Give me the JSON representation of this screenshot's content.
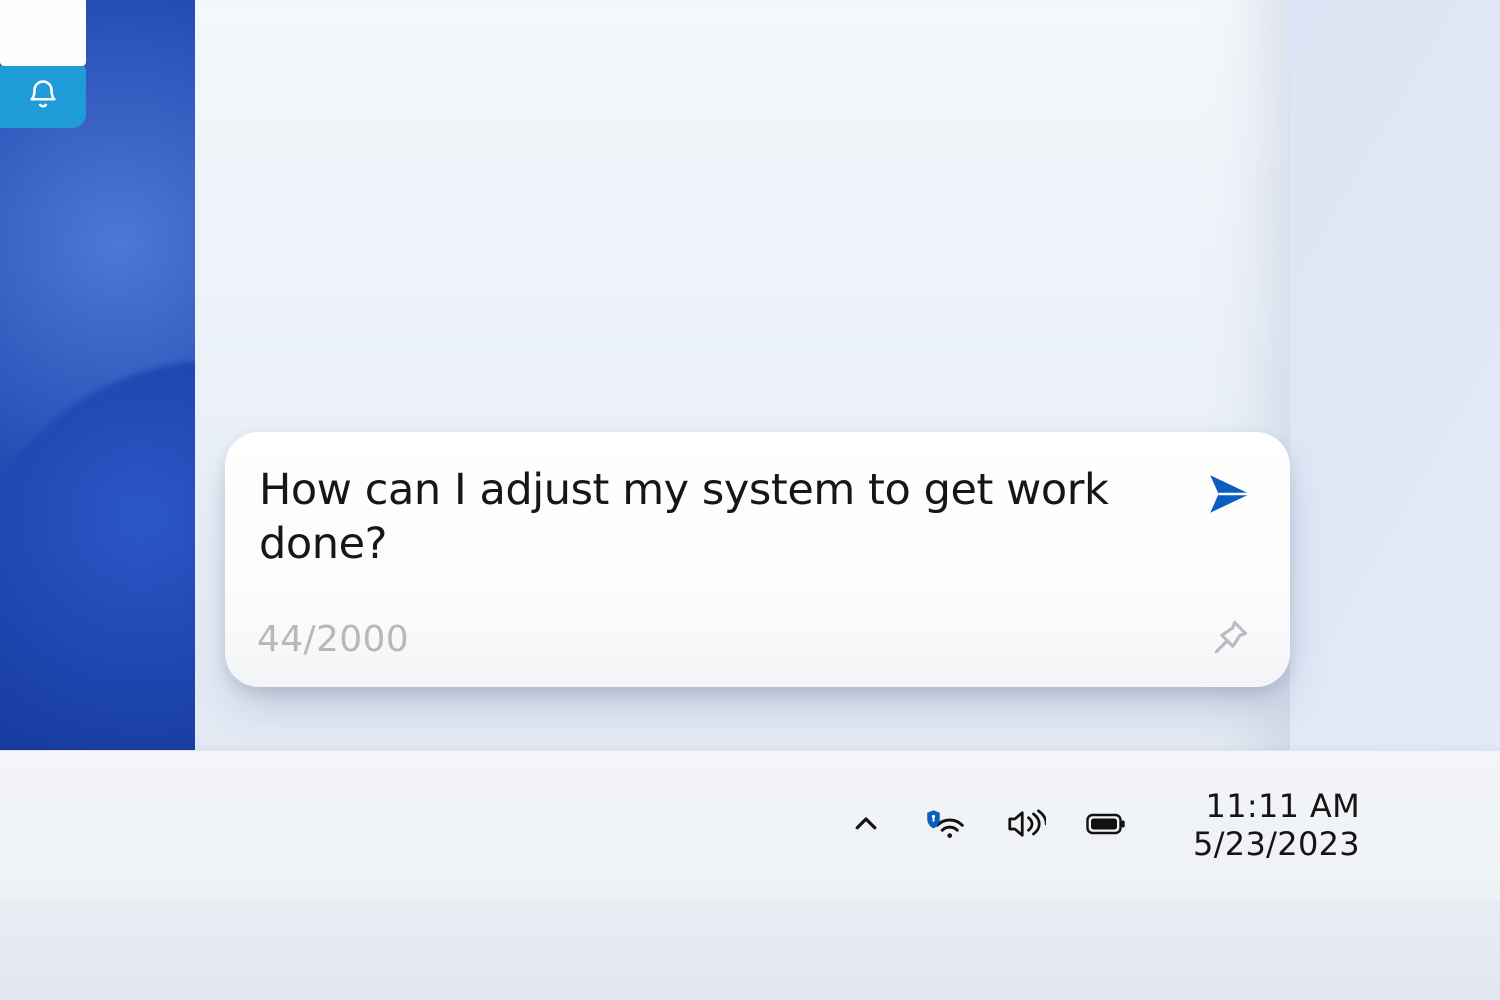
{
  "sidebar": {
    "notification_icon": "bell-icon"
  },
  "chat": {
    "input_value": "How can I adjust my system to get work done?",
    "counter": "44/2000",
    "send_icon": "send-icon",
    "pin_icon": "pin-icon"
  },
  "taskbar": {
    "tray": {
      "overflow_icon": "chevron-up-icon",
      "network_icon": "wifi-secure-icon",
      "volume_icon": "speaker-icon",
      "battery_icon": "battery-icon"
    },
    "clock": {
      "time": "11:11 AM",
      "date": "5/23/2023"
    }
  },
  "colors": {
    "accent": "#0a5ec2",
    "notif_tab": "#1f9bd7",
    "muted": "#b6b8bc"
  }
}
